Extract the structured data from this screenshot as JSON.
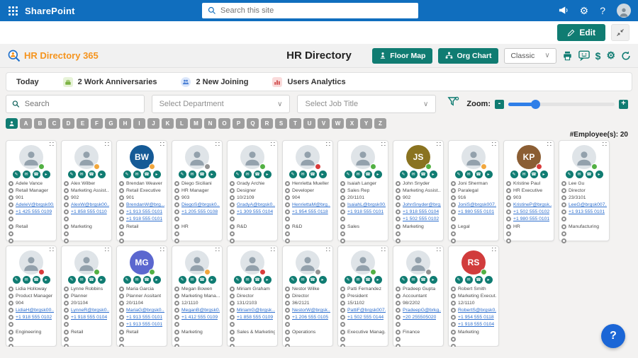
{
  "topbar": {
    "brand": "SharePoint",
    "search_placeholder": "Search this site"
  },
  "commandbar": {
    "edit_label": "Edit"
  },
  "header": {
    "logo_text": "HR Directory 365",
    "title": "HR Directory",
    "floor_map_label": "Floor Map",
    "org_chart_label": "Org Chart",
    "view_value": "Classic",
    "dollar_label": "$"
  },
  "events": {
    "today": "Today",
    "anniversaries": "2 Work Anniversaries",
    "new_joining": "2 New Joining",
    "analytics": "Users Analytics"
  },
  "filters": {
    "search_placeholder": "Search",
    "department_placeholder": "Select Department",
    "job_title_placeholder": "Select Job Title",
    "zoom_label": "Zoom:",
    "zoom_minus": "-",
    "zoom_plus": "+"
  },
  "alphabet": [
    "A",
    "B",
    "C",
    "D",
    "E",
    "F",
    "G",
    "H",
    "I",
    "J",
    "K",
    "L",
    "M",
    "N",
    "O",
    "P",
    "Q",
    "R",
    "S",
    "T",
    "U",
    "V",
    "W",
    "X",
    "Y",
    "Z"
  ],
  "count_label": "#Employee(s): 20",
  "help_label": "?",
  "colors": {
    "accent": "#107c72",
    "topbar_blue": "#106ebe",
    "link_blue": "#2e6fce",
    "logo_orange": "#f5941e",
    "presence": {
      "available": "#52b043",
      "away": "#f2a73d",
      "busy": "#d93b3b",
      "offline": "#949494"
    }
  },
  "employees": [
    {
      "name": "Adele Vance",
      "title": "Retail Manager",
      "dialer": "901",
      "email": "AdeleV@brgsk00...",
      "phone": "+1 425 555 0109",
      "mobile": "",
      "department": "Retail",
      "presence": "available",
      "avatar": {
        "type": "photo"
      }
    },
    {
      "name": "Alex Wilber",
      "title": "Marketing Assist...",
      "dialer": "902",
      "email": "AlexW@brgsk00...",
      "phone": "+1 858 555 0110",
      "mobile": "",
      "department": "Marketing",
      "presence": "away",
      "avatar": {
        "type": "photo"
      }
    },
    {
      "name": "Brendan Weaver",
      "title": "Retail Executive",
      "dialer": "901",
      "email": "BrendanW@brg...",
      "phone": "+1 913 555 0101",
      "mobile": "+1 918 555 0101",
      "department": "Retail",
      "presence": "away",
      "avatar": {
        "type": "initials",
        "text": "BW",
        "color": "#155a96"
      }
    },
    {
      "name": "Diego Siciliani",
      "title": "HR Manager",
      "dialer": "903",
      "email": "DiegoS@brgsk0...",
      "phone": "+1 205 555 0108",
      "mobile": "",
      "department": "HR",
      "presence": "offline",
      "avatar": {
        "type": "photo"
      }
    },
    {
      "name": "Grady Archie",
      "title": "Designer",
      "dialer": "10/2109",
      "email": "GradyA@brgsk0...",
      "phone": "+1 309 555 0104",
      "mobile": "",
      "department": "R&D",
      "presence": "available",
      "avatar": {
        "type": "photo"
      }
    },
    {
      "name": "Henrietta Mueller",
      "title": "Developer",
      "dialer": "904",
      "email": "HenriettaM@brg...",
      "phone": "+1 954 555 0118",
      "mobile": "",
      "department": "R&D",
      "presence": "busy",
      "avatar": {
        "type": "photo"
      }
    },
    {
      "name": "Isaiah Langer",
      "title": "Sales Rep",
      "dialer": "20/1101",
      "email": "IsaiahL@brgsk00...",
      "phone": "+1 918 555 0101",
      "mobile": "",
      "department": "Sales",
      "presence": "available",
      "avatar": {
        "type": "photo"
      }
    },
    {
      "name": "John Snyder",
      "title": "Marketing Assist...",
      "dialer": "902",
      "email": "JohnSnyder@brg...",
      "phone": "+1 918 555 0104",
      "mobile": "+1 502 555 0102",
      "department": "Marketing",
      "presence": "available",
      "avatar": {
        "type": "initials",
        "text": "JS",
        "color": "#8a7320"
      }
    },
    {
      "name": "Joni Sherman",
      "title": "Paralegal",
      "dialer": "916",
      "email": "JoniS@brgsk007...",
      "phone": "+1 980 555 0101",
      "mobile": "",
      "department": "Legal",
      "presence": "away",
      "avatar": {
        "type": "photo"
      }
    },
    {
      "name": "Kristine Paul",
      "title": "HR Executive",
      "dialer": "903",
      "email": "KristineP@brgsk...",
      "phone": "+1 502 555 0102",
      "mobile": "+1 980 555 0101",
      "department": "HR",
      "presence": "busy",
      "avatar": {
        "type": "initials",
        "text": "KP",
        "color": "#8b5e34"
      }
    },
    {
      "name": "Lee Gu",
      "title": "Director",
      "dialer": "23/3101",
      "email": "LeeG@brgsk007...",
      "phone": "+1 913 555 0101",
      "mobile": "",
      "department": "Manufacturing",
      "presence": "available",
      "avatar": {
        "type": "photo"
      }
    },
    {
      "name": "Lidia Holloway",
      "title": "Product Manager",
      "dialer": "904",
      "email": "LidiaH@brgsk00...",
      "phone": "+1 918 555 0102",
      "mobile": "",
      "department": "Engineering",
      "presence": "busy",
      "avatar": {
        "type": "photo"
      }
    },
    {
      "name": "Lynne Robbins",
      "title": "Planner",
      "dialer": "20/1104",
      "email": "LynneR@brgsk0...",
      "phone": "+1 918 555 0104",
      "mobile": "",
      "department": "Retail",
      "presence": "available",
      "avatar": {
        "type": "photo"
      }
    },
    {
      "name": "Maria Garcia",
      "title": "Planner Assitant",
      "dialer": "20/1104",
      "email": "MariaG@brgsk0...",
      "phone": "+1 913 555 0101",
      "mobile": "+1 913 555 0101",
      "department": "Retail",
      "presence": "available",
      "avatar": {
        "type": "initials",
        "text": "MG",
        "color": "#5b67cf"
      }
    },
    {
      "name": "Megan Bowen",
      "title": "Marketing Mana...",
      "dialer": "12/1110",
      "email": "MeganB@brgsk0...",
      "phone": "+1 412 555 0109",
      "mobile": "",
      "department": "Marketing",
      "presence": "away",
      "avatar": {
        "type": "photo"
      }
    },
    {
      "name": "Miriam Graham",
      "title": "Director",
      "dialer": "131/2103",
      "email": "MiriamG@brgsk...",
      "phone": "+1 858 555 0109",
      "mobile": "",
      "department": "Sales & Marketing",
      "presence": "busy",
      "avatar": {
        "type": "photo"
      }
    },
    {
      "name": "Nestor Wilke",
      "title": "Director",
      "dialer": "36/2121",
      "email": "NestorW@brgsk...",
      "phone": "+1 206 555 0105",
      "mobile": "",
      "department": "Operations",
      "presence": "offline",
      "avatar": {
        "type": "photo"
      }
    },
    {
      "name": "Patti Fernandez",
      "title": "President",
      "dialer": "15/1102",
      "email": "PattiF@brgsk007...",
      "phone": "+1 502 555 0144",
      "mobile": "",
      "department": "Executive Manag...",
      "presence": "available",
      "avatar": {
        "type": "photo"
      }
    },
    {
      "name": "Pradeep Gupta",
      "title": "Accountant",
      "dialer": "98/2202",
      "email": "PradeepG@brkg...",
      "phone": "+20 255505020",
      "mobile": "",
      "department": "Finance",
      "presence": "offline",
      "avatar": {
        "type": "photo"
      }
    },
    {
      "name": "Robert Smith",
      "title": "Marketing Execut...",
      "dialer": "12/1110",
      "email": "RobertS@brgsk0...",
      "phone": "+1 954 555 0118",
      "mobile": "+1 918 555 0104",
      "department": "Marketing",
      "presence": "available",
      "avatar": {
        "type": "initials",
        "text": "RS",
        "color": "#d13c3c"
      }
    }
  ]
}
